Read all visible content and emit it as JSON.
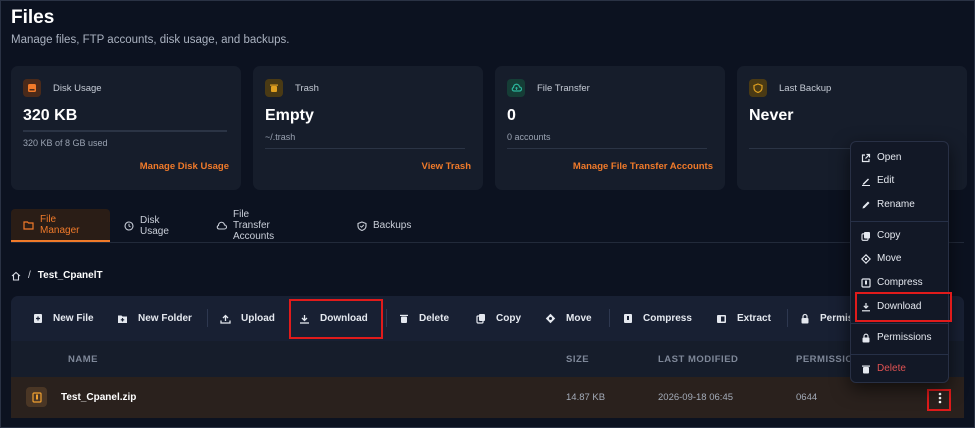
{
  "header": {
    "title": "Files",
    "subtitle": "Manage files, FTP accounts, disk usage, and backups."
  },
  "cards": [
    {
      "label": "Disk Usage",
      "value": "320 KB",
      "detail": "320 KB of 8 GB used",
      "usage_fraction": 0.0,
      "link": "Manage Disk Usage",
      "icon": "hard-drive-icon",
      "icon_color": "#f07a2a"
    },
    {
      "label": "Trash",
      "value": "Empty",
      "detail": "~/.trash",
      "link": "View Trash",
      "icon": "trash-icon",
      "icon_color": "#e0a020"
    },
    {
      "label": "File Transfer",
      "value": "0",
      "detail": "0 accounts",
      "link": "Manage File Transfer Accounts",
      "icon": "cloud-upload-icon",
      "icon_color": "#2bb39a"
    },
    {
      "label": "Last Backup",
      "value": "Never",
      "icon": "shield-icon",
      "icon_color": "#e0a020"
    }
  ],
  "tabs": [
    {
      "label": "File Manager",
      "active": true,
      "icon": "folder-icon"
    },
    {
      "label": "Disk Usage",
      "active": false,
      "icon": "clock-icon"
    },
    {
      "label": "File Transfer Accounts",
      "active": false,
      "icon": "cloud-icon"
    },
    {
      "label": "Backups",
      "active": false,
      "icon": "shield-check-icon"
    }
  ],
  "breadcrumb": {
    "current": "Test_CpanelT",
    "icon": "home-icon"
  },
  "toolbar": {
    "new_file": "New File",
    "new_folder": "New Folder",
    "upload": "Upload",
    "download": "Download",
    "delete": "Delete",
    "copy": "Copy",
    "move": "Move",
    "compress": "Compress",
    "extract": "Extract",
    "permissions": "Permis"
  },
  "table": {
    "headers": {
      "name": "NAME",
      "size": "SIZE",
      "modified": "LAST MODIFIED",
      "permissions": "PERMISSIO"
    },
    "rows": [
      {
        "name": "Test_Cpanel.zip",
        "size": "14.87 KB",
        "modified": "2026-09-18 06:45",
        "permissions": "0644"
      }
    ]
  },
  "context_menu": {
    "open": "Open",
    "edit": "Edit",
    "rename": "Rename",
    "copy": "Copy",
    "move": "Move",
    "compress": "Compress",
    "download": "Download",
    "permissions": "Permissions",
    "delete": "Delete"
  },
  "colors": {
    "accent": "#f07a2a",
    "highlight": "#e01b1b",
    "danger": "#e05252"
  }
}
